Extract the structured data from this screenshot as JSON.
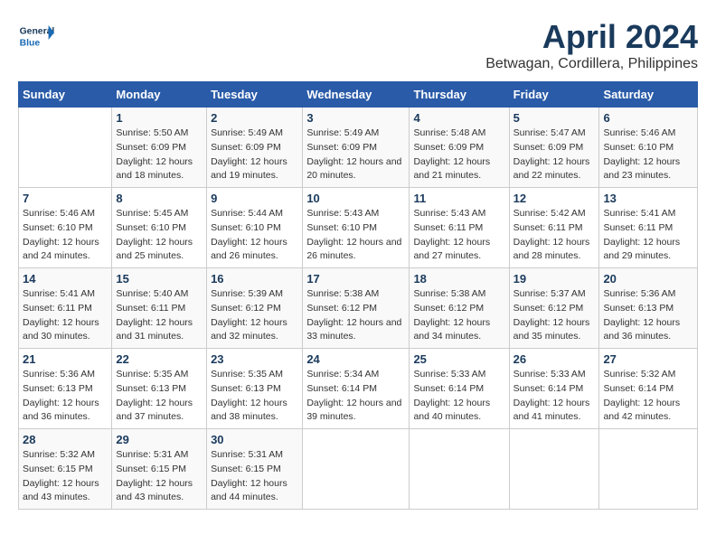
{
  "logo": {
    "text_general": "General",
    "text_blue": "Blue"
  },
  "title": "April 2024",
  "subtitle": "Betwagan, Cordillera, Philippines",
  "header": {
    "days": [
      "Sunday",
      "Monday",
      "Tuesday",
      "Wednesday",
      "Thursday",
      "Friday",
      "Saturday"
    ]
  },
  "weeks": [
    {
      "cells": [
        {
          "day": "",
          "info": ""
        },
        {
          "day": "1",
          "sunrise": "Sunrise: 5:50 AM",
          "sunset": "Sunset: 6:09 PM",
          "daylight": "Daylight: 12 hours and 18 minutes."
        },
        {
          "day": "2",
          "sunrise": "Sunrise: 5:49 AM",
          "sunset": "Sunset: 6:09 PM",
          "daylight": "Daylight: 12 hours and 19 minutes."
        },
        {
          "day": "3",
          "sunrise": "Sunrise: 5:49 AM",
          "sunset": "Sunset: 6:09 PM",
          "daylight": "Daylight: 12 hours and 20 minutes."
        },
        {
          "day": "4",
          "sunrise": "Sunrise: 5:48 AM",
          "sunset": "Sunset: 6:09 PM",
          "daylight": "Daylight: 12 hours and 21 minutes."
        },
        {
          "day": "5",
          "sunrise": "Sunrise: 5:47 AM",
          "sunset": "Sunset: 6:09 PM",
          "daylight": "Daylight: 12 hours and 22 minutes."
        },
        {
          "day": "6",
          "sunrise": "Sunrise: 5:46 AM",
          "sunset": "Sunset: 6:10 PM",
          "daylight": "Daylight: 12 hours and 23 minutes."
        }
      ]
    },
    {
      "cells": [
        {
          "day": "7",
          "sunrise": "Sunrise: 5:46 AM",
          "sunset": "Sunset: 6:10 PM",
          "daylight": "Daylight: 12 hours and 24 minutes."
        },
        {
          "day": "8",
          "sunrise": "Sunrise: 5:45 AM",
          "sunset": "Sunset: 6:10 PM",
          "daylight": "Daylight: 12 hours and 25 minutes."
        },
        {
          "day": "9",
          "sunrise": "Sunrise: 5:44 AM",
          "sunset": "Sunset: 6:10 PM",
          "daylight": "Daylight: 12 hours and 26 minutes."
        },
        {
          "day": "10",
          "sunrise": "Sunrise: 5:43 AM",
          "sunset": "Sunset: 6:10 PM",
          "daylight": "Daylight: 12 hours and 26 minutes."
        },
        {
          "day": "11",
          "sunrise": "Sunrise: 5:43 AM",
          "sunset": "Sunset: 6:11 PM",
          "daylight": "Daylight: 12 hours and 27 minutes."
        },
        {
          "day": "12",
          "sunrise": "Sunrise: 5:42 AM",
          "sunset": "Sunset: 6:11 PM",
          "daylight": "Daylight: 12 hours and 28 minutes."
        },
        {
          "day": "13",
          "sunrise": "Sunrise: 5:41 AM",
          "sunset": "Sunset: 6:11 PM",
          "daylight": "Daylight: 12 hours and 29 minutes."
        }
      ]
    },
    {
      "cells": [
        {
          "day": "14",
          "sunrise": "Sunrise: 5:41 AM",
          "sunset": "Sunset: 6:11 PM",
          "daylight": "Daylight: 12 hours and 30 minutes."
        },
        {
          "day": "15",
          "sunrise": "Sunrise: 5:40 AM",
          "sunset": "Sunset: 6:11 PM",
          "daylight": "Daylight: 12 hours and 31 minutes."
        },
        {
          "day": "16",
          "sunrise": "Sunrise: 5:39 AM",
          "sunset": "Sunset: 6:12 PM",
          "daylight": "Daylight: 12 hours and 32 minutes."
        },
        {
          "day": "17",
          "sunrise": "Sunrise: 5:38 AM",
          "sunset": "Sunset: 6:12 PM",
          "daylight": "Daylight: 12 hours and 33 minutes."
        },
        {
          "day": "18",
          "sunrise": "Sunrise: 5:38 AM",
          "sunset": "Sunset: 6:12 PM",
          "daylight": "Daylight: 12 hours and 34 minutes."
        },
        {
          "day": "19",
          "sunrise": "Sunrise: 5:37 AM",
          "sunset": "Sunset: 6:12 PM",
          "daylight": "Daylight: 12 hours and 35 minutes."
        },
        {
          "day": "20",
          "sunrise": "Sunrise: 5:36 AM",
          "sunset": "Sunset: 6:13 PM",
          "daylight": "Daylight: 12 hours and 36 minutes."
        }
      ]
    },
    {
      "cells": [
        {
          "day": "21",
          "sunrise": "Sunrise: 5:36 AM",
          "sunset": "Sunset: 6:13 PM",
          "daylight": "Daylight: 12 hours and 36 minutes."
        },
        {
          "day": "22",
          "sunrise": "Sunrise: 5:35 AM",
          "sunset": "Sunset: 6:13 PM",
          "daylight": "Daylight: 12 hours and 37 minutes."
        },
        {
          "day": "23",
          "sunrise": "Sunrise: 5:35 AM",
          "sunset": "Sunset: 6:13 PM",
          "daylight": "Daylight: 12 hours and 38 minutes."
        },
        {
          "day": "24",
          "sunrise": "Sunrise: 5:34 AM",
          "sunset": "Sunset: 6:14 PM",
          "daylight": "Daylight: 12 hours and 39 minutes."
        },
        {
          "day": "25",
          "sunrise": "Sunrise: 5:33 AM",
          "sunset": "Sunset: 6:14 PM",
          "daylight": "Daylight: 12 hours and 40 minutes."
        },
        {
          "day": "26",
          "sunrise": "Sunrise: 5:33 AM",
          "sunset": "Sunset: 6:14 PM",
          "daylight": "Daylight: 12 hours and 41 minutes."
        },
        {
          "day": "27",
          "sunrise": "Sunrise: 5:32 AM",
          "sunset": "Sunset: 6:14 PM",
          "daylight": "Daylight: 12 hours and 42 minutes."
        }
      ]
    },
    {
      "cells": [
        {
          "day": "28",
          "sunrise": "Sunrise: 5:32 AM",
          "sunset": "Sunset: 6:15 PM",
          "daylight": "Daylight: 12 hours and 43 minutes."
        },
        {
          "day": "29",
          "sunrise": "Sunrise: 5:31 AM",
          "sunset": "Sunset: 6:15 PM",
          "daylight": "Daylight: 12 hours and 43 minutes."
        },
        {
          "day": "30",
          "sunrise": "Sunrise: 5:31 AM",
          "sunset": "Sunset: 6:15 PM",
          "daylight": "Daylight: 12 hours and 44 minutes."
        },
        {
          "day": "",
          "info": ""
        },
        {
          "day": "",
          "info": ""
        },
        {
          "day": "",
          "info": ""
        },
        {
          "day": "",
          "info": ""
        }
      ]
    }
  ]
}
